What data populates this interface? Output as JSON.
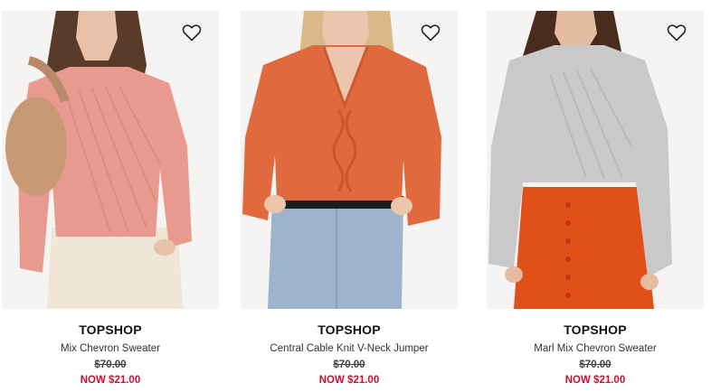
{
  "colors": {
    "sale_red": "#c8102e",
    "text_dark": "#111111",
    "sweater_pink": "#e89a8e",
    "sweater_orange": "#e06a3e",
    "sweater_grey": "#c9c9c9",
    "skirt_orange": "#e2501a",
    "jeans_blue": "#9db4cc",
    "trousers_cream": "#efe6d6"
  },
  "products": [
    {
      "brand": "TOPSHOP",
      "name": "Mix Chevron Sweater",
      "was_price": "$70.00",
      "now_price": "NOW $21.00",
      "wishlist_icon": "heart-outline-icon"
    },
    {
      "brand": "TOPSHOP",
      "name": "Central Cable Knit V-Neck Jumper",
      "was_price": "$70.00",
      "now_price": "NOW $21.00",
      "wishlist_icon": "heart-outline-icon"
    },
    {
      "brand": "TOPSHOP",
      "name": "Marl Mix Chevron Sweater",
      "was_price": "$70.00",
      "now_price": "NOW $21.00",
      "wishlist_icon": "heart-outline-icon"
    }
  ]
}
